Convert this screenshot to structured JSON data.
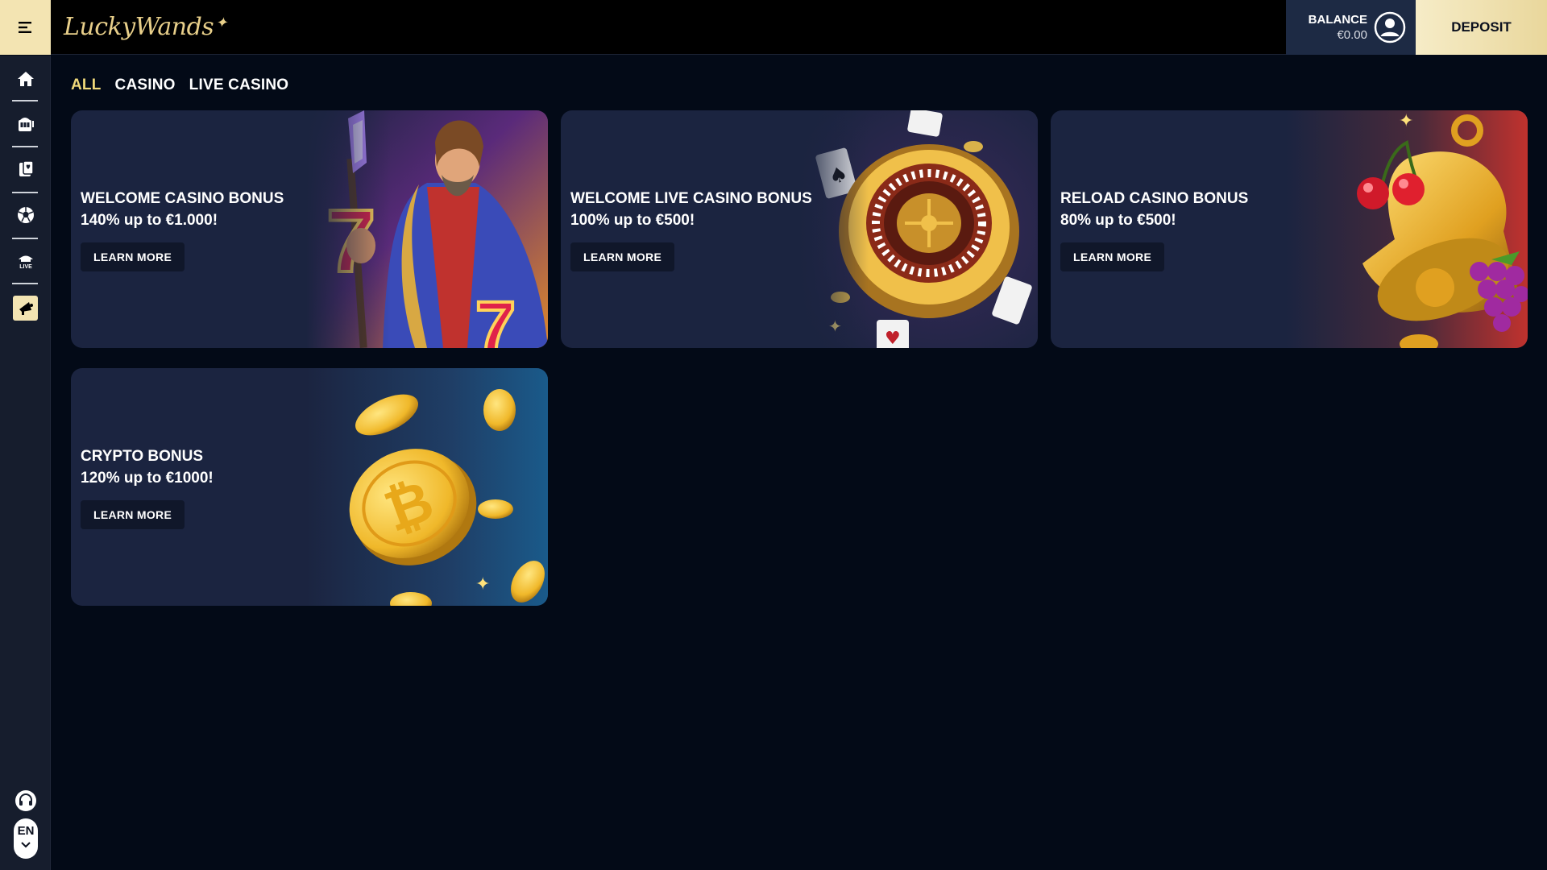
{
  "header": {
    "logo_text": "LuckyWands",
    "balance_label": "BALANCE",
    "balance_value": "€0.00",
    "deposit_label": "DEPOSIT"
  },
  "sidebar": {
    "items": [
      {
        "icon": "home-icon"
      },
      {
        "icon": "slot-machine-icon"
      },
      {
        "icon": "cards-icon"
      },
      {
        "icon": "soccer-ball-icon"
      },
      {
        "icon": "live-casino-icon",
        "label": "LIVE"
      },
      {
        "icon": "promotions-megaphone-icon",
        "active": true
      }
    ],
    "support_icon": "headset-icon",
    "language": "EN"
  },
  "tabs": [
    {
      "label": "ALL",
      "active": true
    },
    {
      "label": "CASINO",
      "active": false
    },
    {
      "label": "LIVE CASINO",
      "active": false
    }
  ],
  "promotions": [
    {
      "title": "WELCOME CASINO BONUS",
      "subtitle": "140% up to €1.000!",
      "button": "LEARN MORE",
      "art": "wizard"
    },
    {
      "title": "WELCOME LIVE CASINO BONUS",
      "subtitle": "100% up to €500!",
      "button": "LEARN MORE",
      "art": "roulette"
    },
    {
      "title": "RELOAD CASINO BONUS",
      "subtitle": "80% up to €500!",
      "button": "LEARN MORE",
      "art": "bell"
    },
    {
      "title": "CRYPTO BONUS",
      "subtitle": "120% up to €1000!",
      "button": "LEARN MORE",
      "art": "bitcoin"
    }
  ],
  "colors": {
    "accent": "#f3e4b2",
    "active_tab": "#f0d97a",
    "background": "#030a17",
    "card": "#1b2440"
  }
}
